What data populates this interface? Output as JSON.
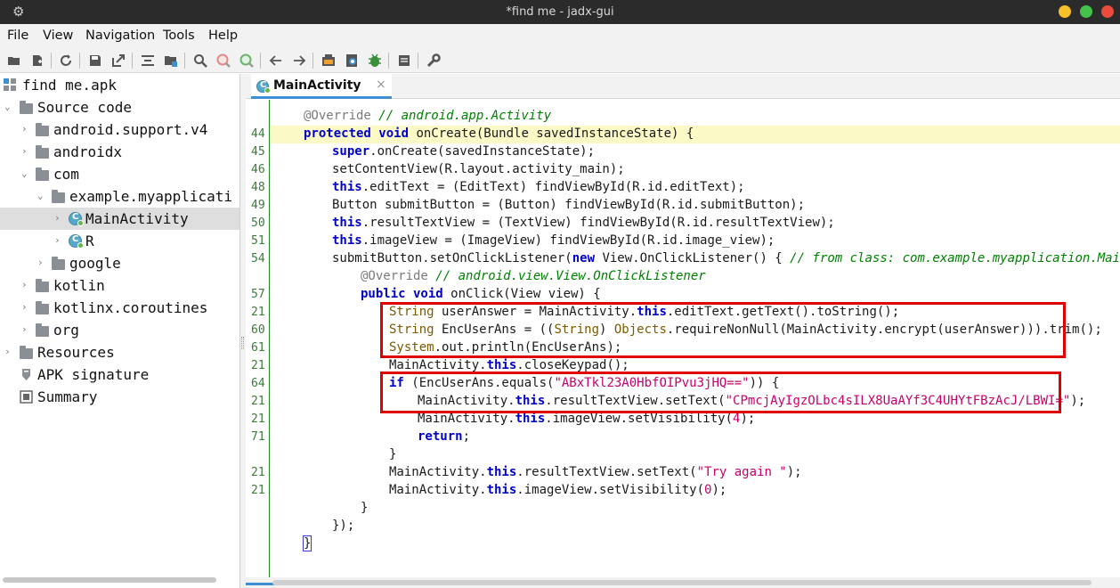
{
  "window": {
    "title": "*find me - jadx-gui",
    "colors": {
      "close": "#e94b3c",
      "minimize": "#f5c02a",
      "maximize": "#45c24a"
    }
  },
  "menu": [
    "File",
    "View",
    "Navigation",
    "Tools",
    "Help"
  ],
  "toolbar": {
    "icons": [
      "open-file-icon",
      "add-files-icon",
      "reload-icon",
      "save-all-icon",
      "export-icon",
      "sync-with-editor-icon",
      "flatten-packages-icon",
      "search-icon",
      "find-class-icon",
      "find-usage-icon",
      "back-icon",
      "forward-icon",
      "deobfuscation-icon",
      "quark-icon",
      "debugger-icon",
      "log-viewer-icon",
      "preferences-icon"
    ]
  },
  "tree": {
    "root": "find me.apk",
    "source_code": "Source code",
    "packages": [
      "android.support.v4",
      "androidx",
      "com"
    ],
    "subpackage": "example.myapplicati",
    "classes": [
      "MainActivity",
      "R"
    ],
    "google": "google",
    "more_packages": [
      "kotlin",
      "kotlinx.coroutines",
      "org"
    ],
    "resources": "Resources",
    "apk_signature": "APK signature",
    "summary": "Summary"
  },
  "editor": {
    "tab_label": "MainActivity",
    "tab_close": "×",
    "line_numbers": [
      "",
      "44",
      "45",
      "46",
      "48",
      "49",
      "50",
      "51",
      "54",
      "",
      "57",
      "21",
      "60",
      "61",
      "21",
      "64",
      "21",
      "21",
      "71",
      "",
      "21",
      "21",
      "",
      "",
      ""
    ]
  },
  "code": {
    "l0_ann": "@Override",
    "l0_cm": " // android.app.Activity",
    "l1_kw": "protected void",
    "l1_rest": " onCreate(Bundle savedInstanceState) {",
    "l2_kw": "super",
    "l2_rest": ".onCreate(savedInstanceState);",
    "l3": "setContentView(R.layout.activity_main);",
    "l4_kw": "this",
    "l4_rest": ".editText = (EditText) findViewById(R.id.editText);",
    "l5": "Button submitButton = (Button) findViewById(R.id.submitButton);",
    "l6_kw": "this",
    "l6_rest": ".resultTextView = (TextView) findViewById(R.id.resultTextView);",
    "l7_kw": "this",
    "l7_rest": ".imageView = (ImageView) findViewById(R.id.image_view);",
    "l8_a": "submitButton.setOnClickListener(",
    "l8_kw": "new",
    "l8_b": " View.OnClickListener() { ",
    "l8_cm": "// from class: com.example.myapplication.MainActi",
    "l9_ann": "@Override",
    "l9_cm": " // android.view.View.OnClickListener",
    "l10_kw": "public void",
    "l10_rest": " onClick(View view) {",
    "l11_ty": "String",
    "l11_a": " userAnswer = MainActivity.",
    "l11_kw": "this",
    "l11_b": ".editText.getText().toString();",
    "l12_ty": "String",
    "l12_a": " EncUserAns = ((",
    "l12_ty2": "String",
    "l12_b": ") ",
    "l12_ty3": "Objects",
    "l12_c": ".requireNonNull(MainActivity.encrypt(userAnswer))).trim();",
    "l13_ty": "System",
    "l13_rest": ".out.println(EncUserAns);",
    "l14_a": "MainActivity.",
    "l14_kw": "this",
    "l14_b": ".closeKeypad();",
    "l15_kw": "if",
    "l15_a": " (EncUserAns.equals(",
    "l15_st": "\"ABxTkl23A0HbfOIPvu3jHQ==\"",
    "l15_b": ")) {",
    "l16_a": "MainActivity.",
    "l16_kw": "this",
    "l16_b": ".resultTextView.setText(",
    "l16_st": "\"CPmcjAyIgzOLbc4sILX8UaAYf3C4UHYtFBzAcJ/LBWI=\"",
    "l16_c": ");",
    "l17_a": "MainActivity.",
    "l17_kw": "this",
    "l17_b": ".imageView.setVisibility(",
    "l17_nu": "4",
    "l17_c": ");",
    "l18_kw": "return",
    "l18_rest": ";",
    "l19": "}",
    "l20_a": "MainActivity.",
    "l20_kw": "this",
    "l20_b": ".resultTextView.setText(",
    "l20_st": "\"Try again \"",
    "l20_c": ");",
    "l21_a": "MainActivity.",
    "l21_kw": "this",
    "l21_b": ".imageView.setVisibility(",
    "l21_nu": "0",
    "l21_c": ");",
    "l22": "}",
    "l23": "});",
    "l24": "}"
  }
}
